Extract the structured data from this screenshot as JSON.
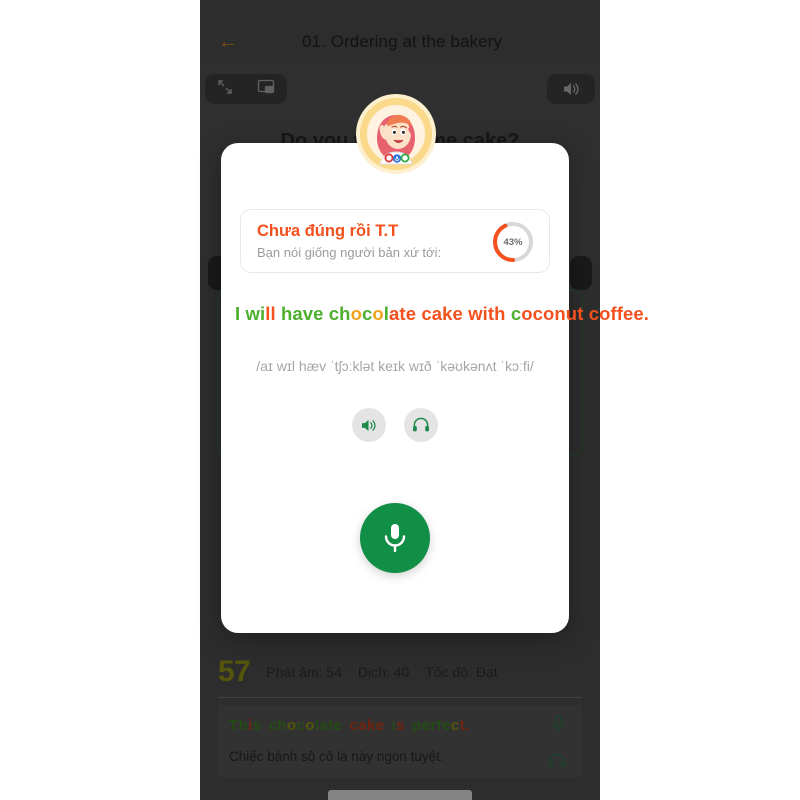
{
  "background": {
    "header": {
      "back_icon": "arrow-left-icon",
      "title": "01. Ordering at the bakery"
    },
    "video_controls": {
      "expand_icon": "expand-arrows-icon",
      "pip_icon": "picture-in-picture-icon",
      "volume_icon": "volume-up-icon",
      "caption": "Do you want some cake?"
    },
    "score_strip": {
      "total": "57",
      "pronunciation": "Phát âm: 54",
      "translation": "Dịch: 40",
      "speed": "Tốc độ: Đạt"
    },
    "transcript": {
      "words": [
        {
          "t": "Th",
          "c": "#3d7a22"
        },
        {
          "t": "i",
          "c": "#b33a1a"
        },
        {
          "t": "s",
          "c": "#3d7a22"
        },
        {
          "t": " ",
          "c": "#3d7a22"
        },
        {
          "t": "ch",
          "c": "#3d7a22"
        },
        {
          "t": "o",
          "c": "#8a8a12"
        },
        {
          "t": "c",
          "c": "#3d7a22"
        },
        {
          "t": "o",
          "c": "#8a8a12"
        },
        {
          "t": "late",
          "c": "#3d7a22"
        },
        {
          "t": " ",
          "c": "#3d7a22"
        },
        {
          "t": "cake",
          "c": "#b33a1a"
        },
        {
          "t": " ",
          "c": "#3d7a22"
        },
        {
          "t": "i",
          "c": "#3d7a22"
        },
        {
          "t": "s",
          "c": "#b33a1a"
        },
        {
          "t": " ",
          "c": "#3d7a22"
        },
        {
          "t": "perfe",
          "c": "#3d7a22"
        },
        {
          "t": "c",
          "c": "#8a8a12"
        },
        {
          "t": "t.",
          "c": "#b33a1a"
        }
      ],
      "translation": "Chiếc bánh sô cô la này ngon tuyệt.",
      "mic_icon": "microphone-outline-icon",
      "headphone_icon": "headphones-outline-icon"
    }
  },
  "modal": {
    "avatar_icon": "teacher-avatar-icon",
    "result": {
      "title": "Chưa đúng rồi T.T",
      "subtitle": "Bạn nói giống người bản xứ tới:",
      "percent_label": "43%",
      "percent_value": 43,
      "ring_color": "#f4511e",
      "ring_track": "#d8d8d8"
    },
    "sentence_words": [
      {
        "t": "I",
        "c": "#4caf2e"
      },
      {
        "t": " ",
        "c": "#4caf2e"
      },
      {
        "t": "wi",
        "c": "#4caf2e"
      },
      {
        "t": "ll",
        "c": "#f4511e"
      },
      {
        "t": " ",
        "c": "#4caf2e"
      },
      {
        "t": "have",
        "c": "#4caf2e"
      },
      {
        "t": " ",
        "c": "#4caf2e"
      },
      {
        "t": "ch",
        "c": "#4caf2e"
      },
      {
        "t": "o",
        "c": "#f0a31a"
      },
      {
        "t": "c",
        "c": "#4caf2e"
      },
      {
        "t": "o",
        "c": "#f0a31a"
      },
      {
        "t": "l",
        "c": "#4caf2e"
      },
      {
        "t": "ate",
        "c": "#f4511e"
      },
      {
        "t": " ",
        "c": "#f4511e"
      },
      {
        "t": "cake",
        "c": "#f4511e"
      },
      {
        "t": " ",
        "c": "#f4511e"
      },
      {
        "t": "with",
        "c": "#f4511e"
      },
      {
        "t": " ",
        "c": "#f4511e"
      },
      {
        "t": "c",
        "c": "#4caf2e"
      },
      {
        "t": "oconut",
        "c": "#f4511e"
      },
      {
        "t": " ",
        "c": "#f4511e"
      },
      {
        "t": "coffee.",
        "c": "#f4511e"
      }
    ],
    "ipa": "/aɪ wɪl hæv ˈtʃɔːklət keɪk wɪð ˈkəʊkənʌt ˈkɔːfi/",
    "speaker_icon": "volume-up-icon",
    "headphone_icon": "headphones-icon",
    "mic_icon": "microphone-icon",
    "mic_color": "#128f47"
  }
}
